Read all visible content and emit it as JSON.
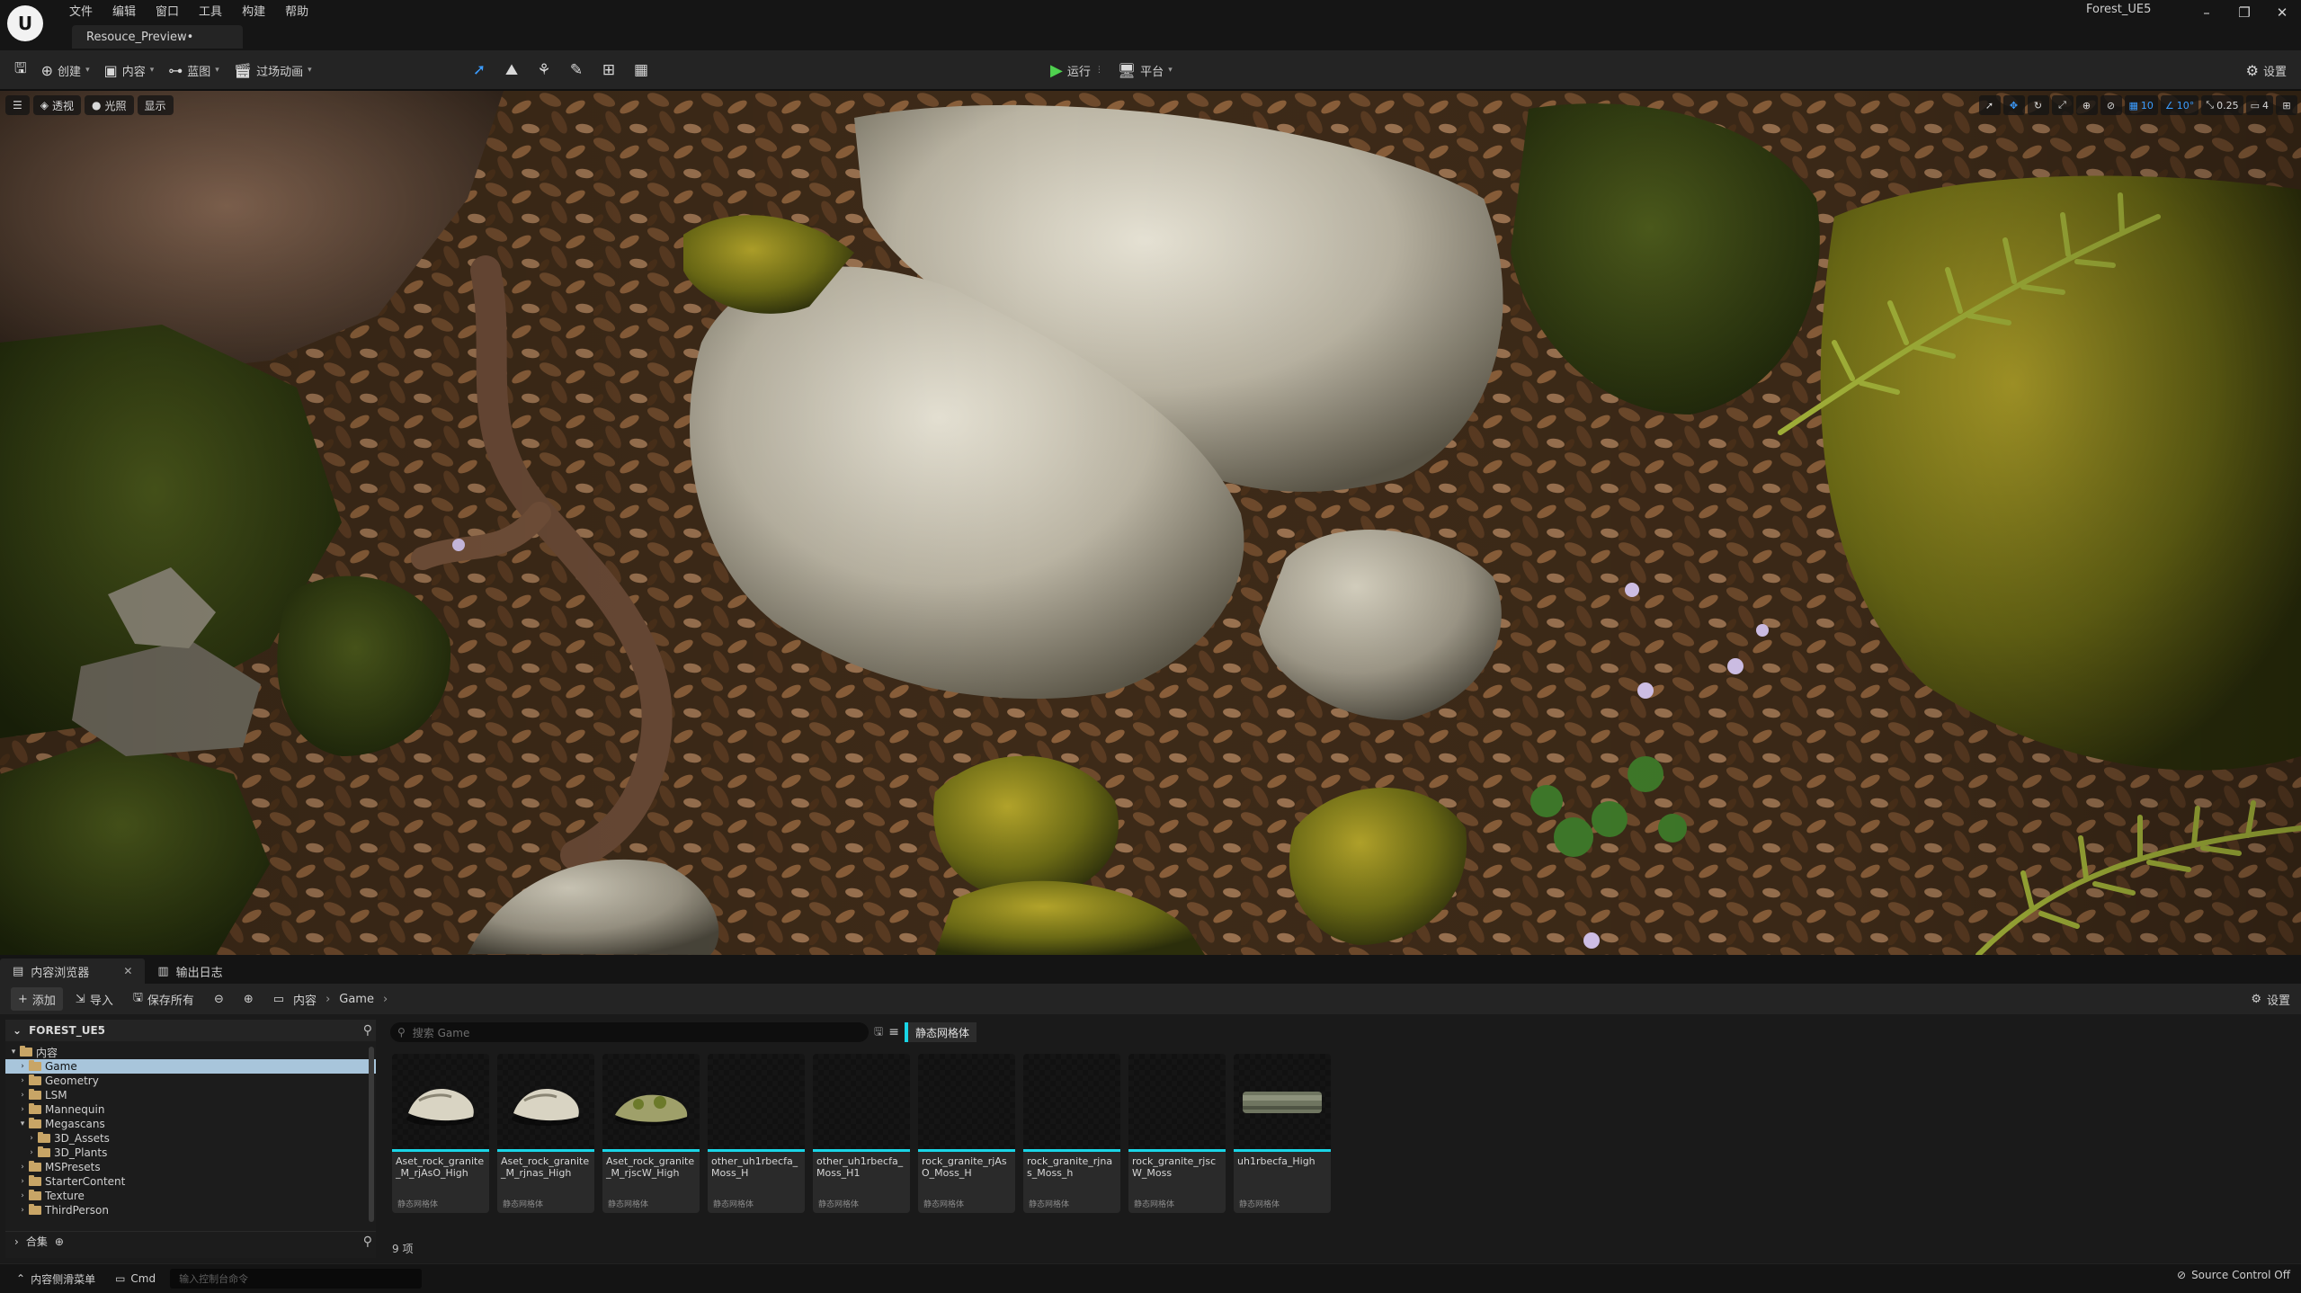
{
  "window": {
    "title_tab": "Resouce_Preview•",
    "project": "Forest_UE5",
    "controls": [
      "–",
      "❐",
      "✕"
    ]
  },
  "menu": [
    "文件",
    "编辑",
    "窗口",
    "工具",
    "构建",
    "帮助"
  ],
  "toolbar": {
    "create": "创建",
    "content": "内容",
    "blueprint": "蓝图",
    "cinematics": "过场动画",
    "run": "运行",
    "platform": "平台",
    "settings": "设置"
  },
  "viewport": {
    "perspective": "透视",
    "lit": "光照",
    "show": "显示",
    "grid_snap": "10",
    "rot_snap": "10°",
    "scale_snap": "0.25",
    "camera_speed": "4"
  },
  "drawer": {
    "tab_content_browser": "内容浏览器",
    "tab_output_log": "输出日志",
    "add": "添加",
    "import": "导入",
    "save_all": "保存所有",
    "crumb_content": "内容",
    "crumb_game": "Game",
    "settings": "设置",
    "tree_title": "FOREST_UE5",
    "tree": [
      {
        "label": "内容",
        "depth": 0,
        "open": true,
        "sel": false
      },
      {
        "label": "Game",
        "depth": 1,
        "open": false,
        "sel": true
      },
      {
        "label": "Geometry",
        "depth": 1,
        "open": false,
        "sel": false
      },
      {
        "label": "LSM",
        "depth": 1,
        "open": false,
        "sel": false
      },
      {
        "label": "Mannequin",
        "depth": 1,
        "open": false,
        "sel": false
      },
      {
        "label": "Megascans",
        "depth": 1,
        "open": true,
        "sel": false
      },
      {
        "label": "3D_Assets",
        "depth": 2,
        "open": false,
        "sel": false
      },
      {
        "label": "3D_Plants",
        "depth": 2,
        "open": false,
        "sel": false
      },
      {
        "label": "MSPresets",
        "depth": 1,
        "open": false,
        "sel": false
      },
      {
        "label": "StarterContent",
        "depth": 1,
        "open": false,
        "sel": false
      },
      {
        "label": "Texture",
        "depth": 1,
        "open": false,
        "sel": false
      },
      {
        "label": "ThirdPerson",
        "depth": 1,
        "open": false,
        "sel": false
      }
    ],
    "collections": "合集",
    "search_placeholder": "搜索 Game",
    "filter_chip": "静态网格体",
    "item_count": "9 项",
    "assets": [
      {
        "name": "Aset_rock_granite_M_rjAsO_High",
        "type": "静态网格体",
        "thumb": "rock-light"
      },
      {
        "name": "Aset_rock_granite_M_rjnas_High",
        "type": "静态网格体",
        "thumb": "rock-light"
      },
      {
        "name": "Aset_rock_granite_M_rjscW_High",
        "type": "静态网格体",
        "thumb": "rock-moss"
      },
      {
        "name": "other_uh1rbecfa_Moss_H",
        "type": "静态网格体",
        "thumb": "empty"
      },
      {
        "name": "other_uh1rbecfa_Moss_H1",
        "type": "静态网格体",
        "thumb": "empty"
      },
      {
        "name": "rock_granite_rjAsO_Moss_H",
        "type": "静态网格体",
        "thumb": "empty"
      },
      {
        "name": "rock_granite_rjnas_Moss_h",
        "type": "静态网格体",
        "thumb": "empty"
      },
      {
        "name": "rock_granite_rjscW_Moss",
        "type": "静态网格体",
        "thumb": "empty"
      },
      {
        "name": "uh1rbecfa_High",
        "type": "静态网格体",
        "thumb": "log"
      }
    ]
  },
  "status": {
    "drawer_menu": "内容侧滑菜单",
    "cmd": "Cmd",
    "cmd_placeholder": "输入控制台命令",
    "source_control": "Source Control Off"
  }
}
